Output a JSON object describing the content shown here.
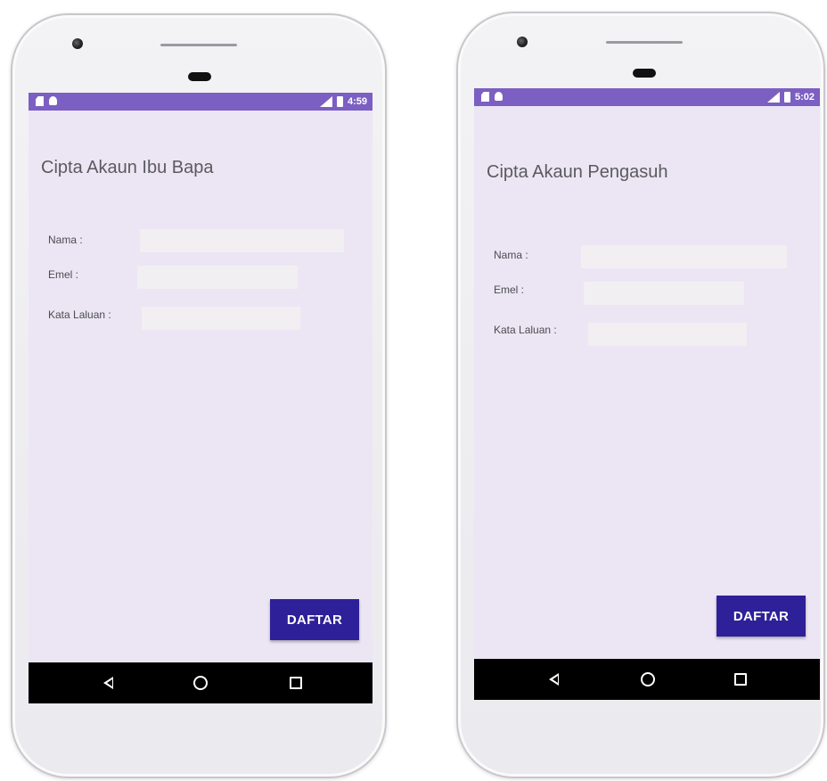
{
  "phones": [
    {
      "status_time": "4:59",
      "title": "Cipta Akaun Ibu Bapa",
      "fields": [
        {
          "label": "Nama :",
          "value": ""
        },
        {
          "label": "Emel :",
          "value": ""
        },
        {
          "label": "Kata Laluan :",
          "value": ""
        }
      ],
      "button_label": "DAFTAR"
    },
    {
      "status_time": "5:02",
      "title": "Cipta Akaun Pengasuh",
      "fields": [
        {
          "label": "Nama :",
          "value": ""
        },
        {
          "label": "Emel :",
          "value": ""
        },
        {
          "label": "Kata Laluan :",
          "value": ""
        }
      ],
      "button_label": "DAFTAR"
    }
  ],
  "colors": {
    "status_bar": "#7c5fc2",
    "screen_background": "#ece6f4",
    "button": "#2e2098",
    "button_text": "#ffffff",
    "nav_bar": "#000000",
    "input_background": "#f1eff2"
  },
  "icons": {
    "status_left": [
      "sd-card-icon",
      "android-icon"
    ],
    "status_right": [
      "signal-icon",
      "battery-icon"
    ],
    "nav": [
      "back-icon",
      "home-icon",
      "recent-apps-icon"
    ]
  }
}
